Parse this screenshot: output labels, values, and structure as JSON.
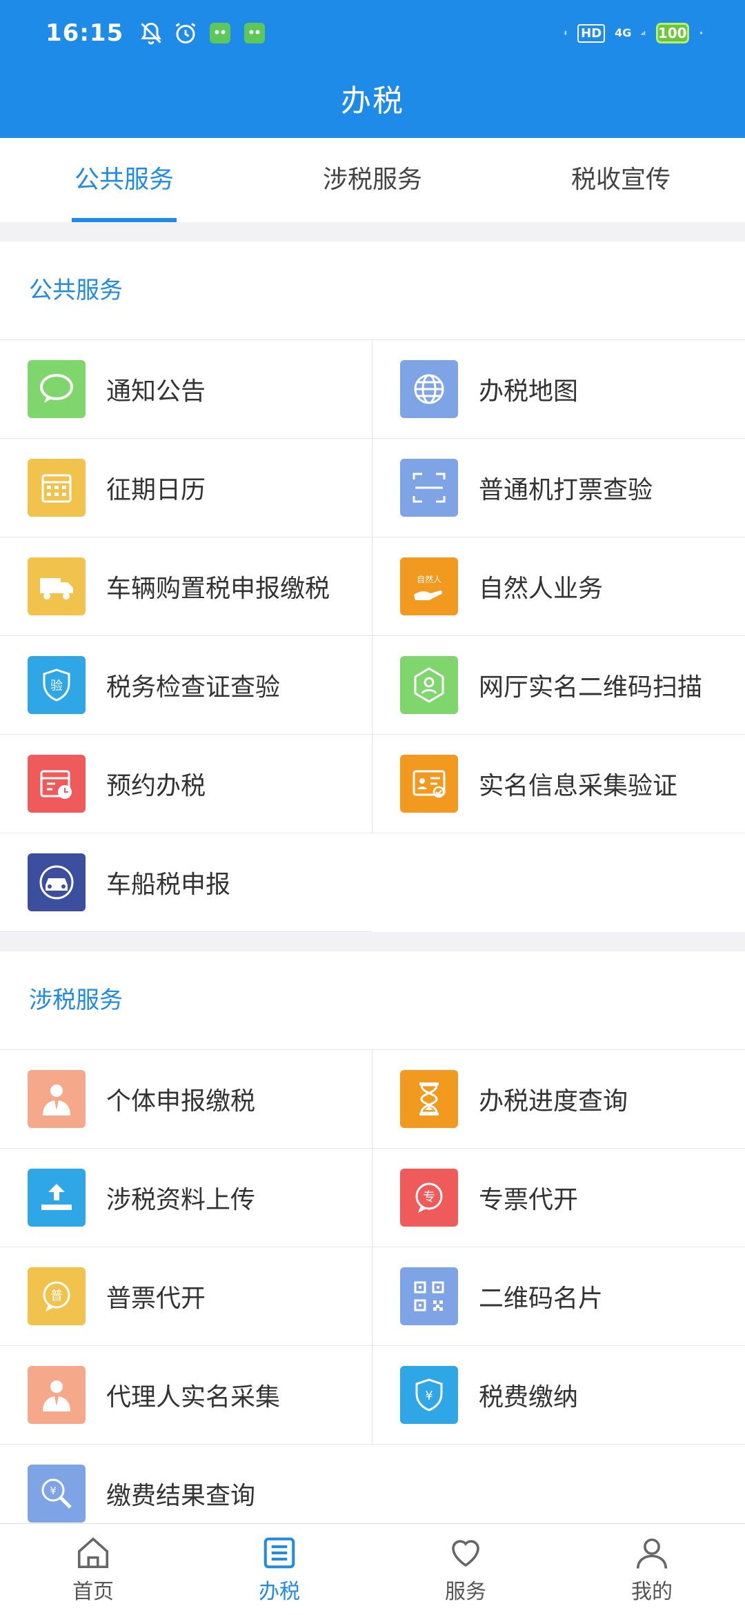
{
  "status": {
    "time": "16:15",
    "hd": "HD",
    "network": "4G",
    "battery": "100"
  },
  "header": {
    "title": "办税"
  },
  "tabs": [
    {
      "label": "公共服务"
    },
    {
      "label": "涉税服务"
    },
    {
      "label": "税收宣传"
    }
  ],
  "sections": {
    "public": {
      "title": "公共服务",
      "items": [
        {
          "label": "通知公告",
          "icon": "chat-bubble-icon",
          "color": "#7ed66c"
        },
        {
          "label": "办税地图",
          "icon": "globe-icon",
          "color": "#7fa4e6"
        },
        {
          "label": "征期日历",
          "icon": "calendar-icon",
          "color": "#f2c34c"
        },
        {
          "label": "普通机打票查验",
          "icon": "scan-frame-icon",
          "color": "#7fa4e6"
        },
        {
          "label": "车辆购置税申报缴税",
          "icon": "truck-icon",
          "color": "#f2c34c"
        },
        {
          "label": "自然人业务",
          "icon": "natural-person-hand-icon",
          "color": "#f29a1f",
          "badge": "自然人"
        },
        {
          "label": "税务检查证查验",
          "icon": "shield-verify-icon",
          "color": "#2fa6e6",
          "badge": "验"
        },
        {
          "label": "网厅实名二维码扫描",
          "icon": "hexagon-person-icon",
          "color": "#7ed66c"
        },
        {
          "label": "预约办税",
          "icon": "calendar-clock-icon",
          "color": "#ef5b5b"
        },
        {
          "label": "实名信息采集验证",
          "icon": "id-card-check-icon",
          "color": "#f29a1f"
        },
        {
          "label": "车船税申报",
          "icon": "car-circle-icon",
          "color": "#3b4f9e"
        }
      ]
    },
    "tax": {
      "title": "涉税服务",
      "items": [
        {
          "label": "个体申报缴税",
          "icon": "person-suit-icon",
          "color": "#f6a98a"
        },
        {
          "label": "办税进度查询",
          "icon": "hourglass-icon",
          "color": "#f29a1f"
        },
        {
          "label": "涉税资料上传",
          "icon": "upload-icon",
          "color": "#2fa6e6"
        },
        {
          "label": "专票代开",
          "icon": "special-invoice-icon",
          "color": "#ef5b5b",
          "badge": "专"
        },
        {
          "label": "普票代开",
          "icon": "general-invoice-icon",
          "color": "#f2c34c",
          "badge": "普"
        },
        {
          "label": "二维码名片",
          "icon": "qr-code-icon",
          "color": "#7fa4e6"
        },
        {
          "label": "代理人实名采集",
          "icon": "person-suit-icon",
          "color": "#f6a98a"
        },
        {
          "label": "税费缴纳",
          "icon": "shield-yuan-icon",
          "color": "#2fa6e6",
          "badge": "¥"
        },
        {
          "label": "缴费结果查询",
          "icon": "magnifier-yuan-icon",
          "color": "#7fa4e6",
          "badge": "¥"
        }
      ]
    }
  },
  "nav": [
    {
      "label": "首页",
      "icon": "home-icon"
    },
    {
      "label": "办税",
      "icon": "list-icon"
    },
    {
      "label": "服务",
      "icon": "heart-icon"
    },
    {
      "label": "我的",
      "icon": "person-icon"
    }
  ]
}
